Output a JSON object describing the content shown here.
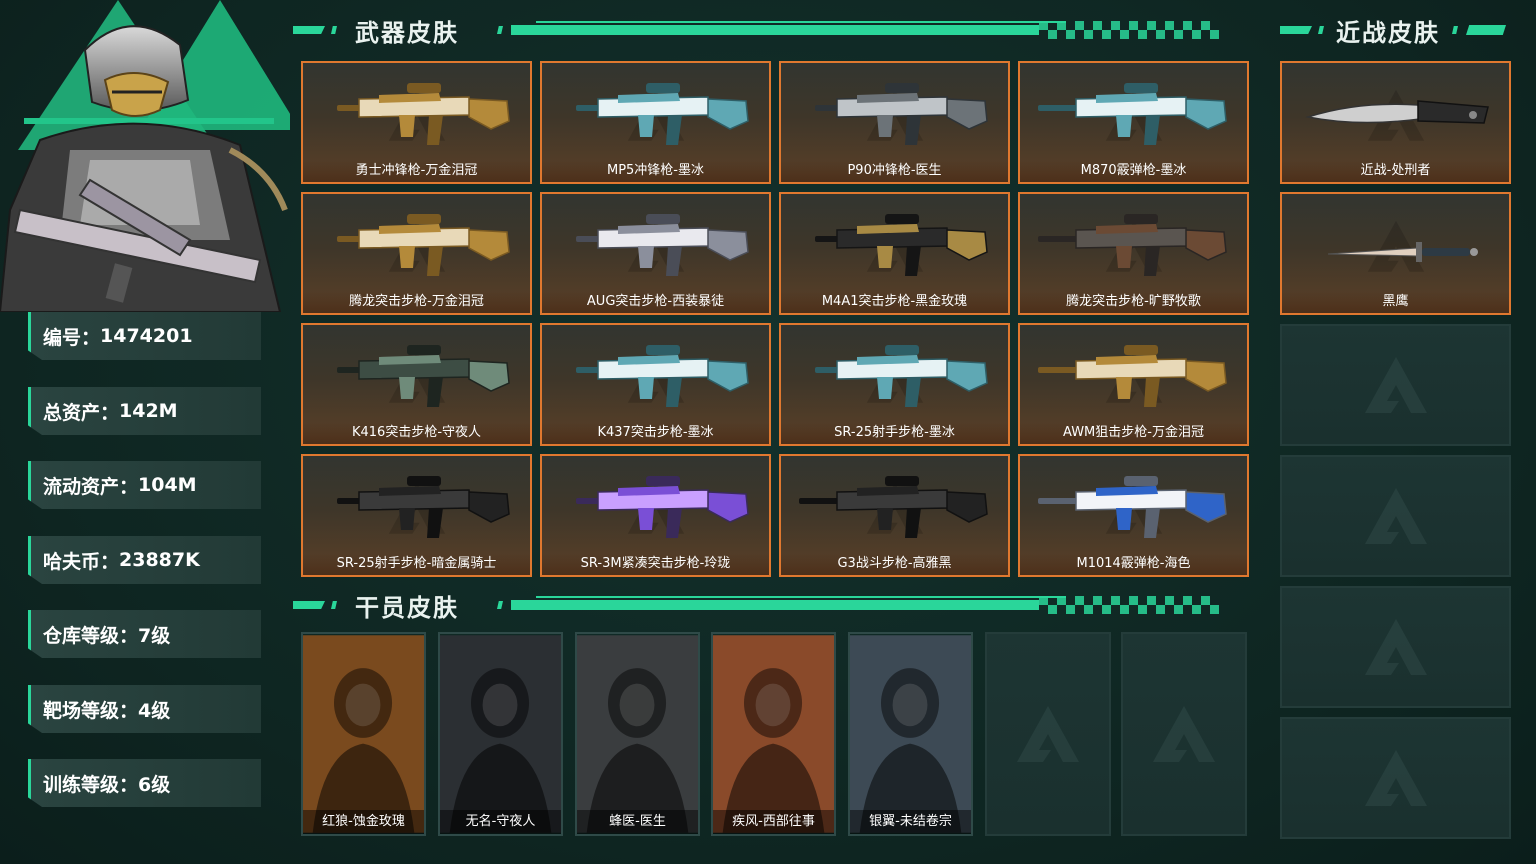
{
  "colors": {
    "accent": "#2ad69a",
    "card_border": "#e0782f",
    "bg": "#102a26"
  },
  "stats": [
    {
      "key": "编号：",
      "value": "1474201"
    },
    {
      "key": "总资产：",
      "value": "142M"
    },
    {
      "key": "流动资产：",
      "value": "104M"
    },
    {
      "key": "哈夫币：",
      "value": "23887K"
    },
    {
      "key": "仓库等级：",
      "value": "7级"
    },
    {
      "key": "靶场等级：",
      "value": "4级"
    },
    {
      "key": "训练等级：",
      "value": "6级"
    }
  ],
  "sections": {
    "weapons": "武器皮肤",
    "melee": "近战皮肤",
    "operators": "干员皮肤"
  },
  "weapons": [
    {
      "name": "勇士冲锋枪-万金泪冠",
      "tone": "gold"
    },
    {
      "name": "MP5冲锋枪-墨冰",
      "tone": "ice"
    },
    {
      "name": "P90冲锋枪-医生",
      "tone": "gray"
    },
    {
      "name": "M870霰弹枪-墨冰",
      "tone": "ice"
    },
    {
      "name": "腾龙突击步枪-万金泪冠",
      "tone": "gold"
    },
    {
      "name": "AUG突击步枪-西装暴徒",
      "tone": "white"
    },
    {
      "name": "M4A1突击步枪-黑金玫瑰",
      "tone": "blackgold"
    },
    {
      "name": "腾龙突击步枪-旷野牧歌",
      "tone": "brown"
    },
    {
      "name": "K416突击步枪-守夜人",
      "tone": "green"
    },
    {
      "name": "K437突击步枪-墨冰",
      "tone": "ice"
    },
    {
      "name": "SR-25射手步枪-墨冰",
      "tone": "ice"
    },
    {
      "name": "AWM狙击步枪-万金泪冠",
      "tone": "gold"
    },
    {
      "name": "SR-25射手步枪-暗金属骑士",
      "tone": "black"
    },
    {
      "name": "SR-3M紧凑突击步枪-玲珑",
      "tone": "purple"
    },
    {
      "name": "G3战斗步枪-高雅黑",
      "tone": "black"
    },
    {
      "name": "M1014霰弹枪-海色",
      "tone": "bluewhite"
    }
  ],
  "melee": [
    {
      "name": "近战-处刑者"
    },
    {
      "name": "黑鹰"
    }
  ],
  "operators": [
    {
      "name": "红狼-蚀金玫瑰",
      "tone": "#7a4a1e"
    },
    {
      "name": "无名-守夜人",
      "tone": "#2b2f33"
    },
    {
      "name": "蜂医-医生",
      "tone": "#3a3d3f"
    },
    {
      "name": "疾风-西部往事",
      "tone": "#8a4a2a"
    },
    {
      "name": "银翼-未结卷宗",
      "tone": "#3d4a55"
    }
  ]
}
